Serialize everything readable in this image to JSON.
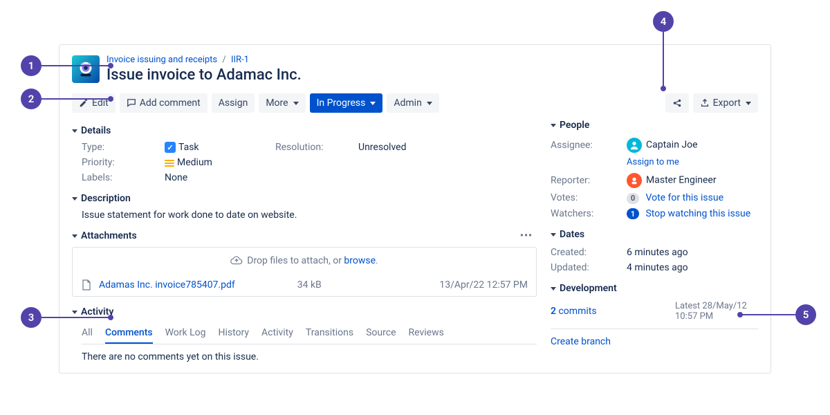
{
  "breadcrumb": {
    "project": "Invoice issuing and receipts",
    "sep": "/",
    "key": "IIR-1"
  },
  "title": "Issue invoice to Adamac Inc.",
  "toolbar": {
    "edit": "Edit",
    "add_comment": "Add comment",
    "assign": "Assign",
    "more": "More",
    "status": "In Progress",
    "admin": "Admin",
    "export": "Export"
  },
  "sections": {
    "details": "Details",
    "description": "Description",
    "attachments": "Attachments",
    "activity": "Activity",
    "people": "People",
    "dates": "Dates",
    "development": "Development"
  },
  "details": {
    "type_label": "Type:",
    "type_value": "Task",
    "resolution_label": "Resolution:",
    "resolution_value": "Unresolved",
    "priority_label": "Priority:",
    "priority_value": "Medium",
    "labels_label": "Labels:",
    "labels_value": "None"
  },
  "description": {
    "text": "Issue statement for work done to date on website."
  },
  "attachments": {
    "drop_hint_prefix": "Drop files to attach, or ",
    "drop_hint_link": "browse",
    "drop_hint_suffix": ".",
    "file_name": "Adamas Inc. invoice785407.pdf",
    "file_size": "34 kB",
    "file_date": "13/Apr/22 12:57 PM",
    "menu": "•••"
  },
  "activity": {
    "tabs": {
      "all": "All",
      "comments": "Comments",
      "worklog": "Work Log",
      "history": "History",
      "activity": "Activity",
      "transitions": "Transitions",
      "source": "Source",
      "reviews": "Reviews"
    },
    "empty": "There are no comments yet on this issue."
  },
  "people": {
    "assignee_label": "Assignee:",
    "assignee_name": "Captain Joe",
    "assign_to_me": "Assign to me",
    "reporter_label": "Reporter:",
    "reporter_name": "Master Engineer",
    "votes_label": "Votes:",
    "votes_count": "0",
    "votes_link": "Vote for this issue",
    "watchers_label": "Watchers:",
    "watchers_count": "1",
    "watchers_link": "Stop watching this issue"
  },
  "dates": {
    "created_label": "Created:",
    "created_value": "6 minutes ago",
    "updated_label": "Updated:",
    "updated_value": "4 minutes ago"
  },
  "development": {
    "commits_count": "2",
    "commits_word": " commits",
    "latest_prefix": "Latest ",
    "latest_date": "28/May/12",
    "latest_time": "10:57 PM",
    "create_branch": "Create branch"
  },
  "annotations": {
    "a1": "1",
    "a2": "2",
    "a3": "3",
    "a4": "4",
    "a5": "5"
  }
}
